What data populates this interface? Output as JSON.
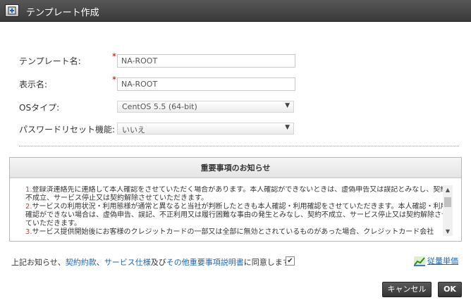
{
  "dialog": {
    "title": "テンプレート作成"
  },
  "form": {
    "template_name": {
      "label": "テンプレート名:",
      "required_mark": "*",
      "value": "NA-ROOT"
    },
    "display_name": {
      "label": "表示名:",
      "required_mark": "*",
      "value": "NA-ROOT"
    },
    "os_type": {
      "label": "OSタイプ:",
      "selected": "CentOS 5.5 (64-bit)"
    },
    "password_reset": {
      "label": "パスワードリセット機能:",
      "selected": "いいえ"
    }
  },
  "notice": {
    "title": "重要事項のお知らせ",
    "items": [
      {
        "num": "1.",
        "text": "登録済連絡先に連絡して本人確認をさせていただく場合があります。本人確認ができないときは、虚偽申告又は誤記とみなし、契約不成立、サービス停止又は契約解除させていただきます。"
      },
      {
        "num": "2.",
        "text": "サービスの利用状況・利用態様が通常と異なると当社が判断したときも本人確認・利用確認をさせていただきます。本人確認・利用確認ができない場合は、虚偽申告、誤記、不正利用又は履行困難な事由の発生とみなし、契約不成立、サービス停止又は契約解除させていただきます。"
      },
      {
        "num": "3.",
        "text": "サービス提供開始後にお客様のクレジットカードの一部又は全部に無効とされているものがあった場合、クレジットカード会社"
      }
    ]
  },
  "agreement": {
    "prefix": "上記お知らせ、",
    "link1": "契約約款",
    "sep1": "、",
    "link2": "サービス仕様",
    "sep2": "及び",
    "link3": "その他重要事項説明書",
    "suffix": "に同意します。",
    "checked_glyph": "✔"
  },
  "rate_link": {
    "label": "従量単価"
  },
  "buttons": {
    "cancel": "キャンセル",
    "ok": "OK"
  },
  "colors": {
    "titlebar": "#3a3a3a",
    "link": "#1a66b2",
    "required": "#b00000",
    "button": "#3a3a3a"
  },
  "icons": {
    "title": "template-add-icon",
    "rate": "chart-icon",
    "dropdown": "triangle-down-icon"
  }
}
